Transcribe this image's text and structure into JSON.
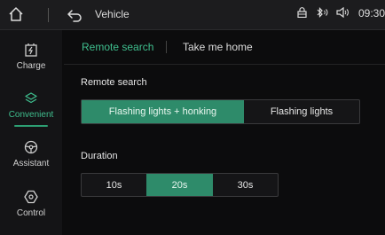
{
  "topbar": {
    "title": "Vehicle",
    "time": "09:30"
  },
  "icons": {
    "home": "home-icon",
    "back": "back-arrow-icon",
    "lock": "lock-icon",
    "bluetooth": "bluetooth-icon",
    "volume": "volume-icon"
  },
  "sidebar": {
    "items": [
      {
        "label": "Charge",
        "icon": "charge-icon"
      },
      {
        "label": "Convenient",
        "icon": "convenient-icon",
        "active": true
      },
      {
        "label": "Assistant",
        "icon": "steering-wheel-icon"
      },
      {
        "label": "Control",
        "icon": "control-icon"
      }
    ]
  },
  "tabs": [
    {
      "label": "Remote search",
      "active": true
    },
    {
      "label": "Take me home",
      "active": false
    }
  ],
  "remote_search": {
    "heading": "Remote search",
    "options": [
      "Flashing lights + honking",
      "Flashing lights"
    ],
    "selected": 0
  },
  "duration": {
    "heading": "Duration",
    "options": [
      "10s",
      "20s",
      "30s"
    ],
    "selected": 1
  },
  "colors": {
    "accent": "#3fbf8e",
    "selected_fill": "#2e8b6a",
    "background": "#0c0c0d"
  }
}
